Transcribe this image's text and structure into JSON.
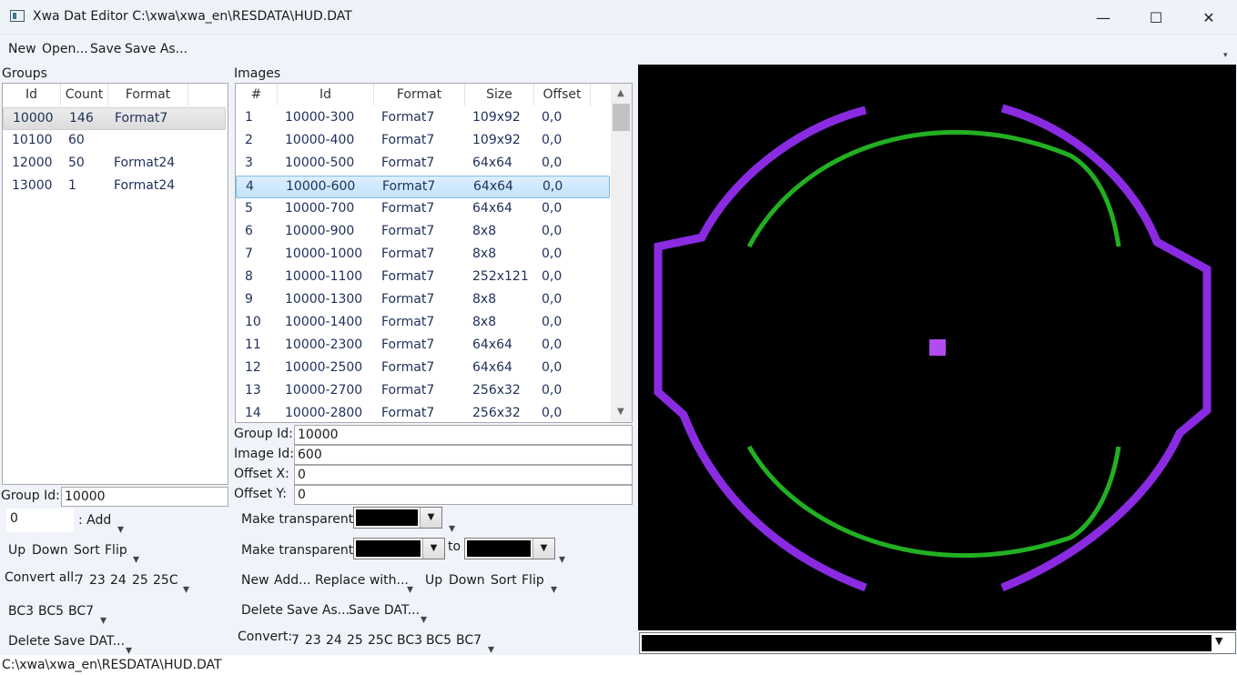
{
  "window": {
    "title": "Xwa Dat Editor C:\\xwa\\xwa_en\\RESDATA\\HUD.DAT",
    "minimize": "—",
    "maximize": "☐",
    "close": "✕"
  },
  "menu": {
    "new": "New",
    "open": "Open...",
    "save": "Save",
    "save_as": "Save As...",
    "overflow": "▾"
  },
  "groups": {
    "title": "Groups",
    "columns": [
      "Id",
      "Count",
      "Format"
    ],
    "rows": [
      {
        "id": "10000",
        "count": "146",
        "format": "Format7"
      },
      {
        "id": "10100",
        "count": "60",
        "format": ""
      },
      {
        "id": "12000",
        "count": "50",
        "format": "Format24"
      },
      {
        "id": "13000",
        "count": "1",
        "format": "Format24"
      }
    ],
    "selected_index": 0,
    "group_id_label": "Group Id:",
    "group_id_value": "10000",
    "add_value": "0",
    "add_label": ": Add",
    "up": "Up",
    "down": "Down",
    "sort": "Sort",
    "flip": "Flip",
    "convert_all_label": "Convert all:",
    "convert_formats_1": [
      "7",
      "23",
      "24",
      "25",
      "25C"
    ],
    "convert_formats_2": [
      "BC3",
      "BC5",
      "BC7"
    ],
    "delete": "Delete",
    "save_dat": "Save DAT..."
  },
  "images": {
    "title": "Images",
    "columns": [
      "#",
      "Id",
      "Format",
      "Size",
      "Offset"
    ],
    "rows": [
      {
        "n": "1",
        "id": "10000-300",
        "format": "Format7",
        "size": "109x92",
        "offset": "0,0"
      },
      {
        "n": "2",
        "id": "10000-400",
        "format": "Format7",
        "size": "109x92",
        "offset": "0,0"
      },
      {
        "n": "3",
        "id": "10000-500",
        "format": "Format7",
        "size": "64x64",
        "offset": "0,0"
      },
      {
        "n": "4",
        "id": "10000-600",
        "format": "Format7",
        "size": "64x64",
        "offset": "0,0"
      },
      {
        "n": "5",
        "id": "10000-700",
        "format": "Format7",
        "size": "64x64",
        "offset": "0,0"
      },
      {
        "n": "6",
        "id": "10000-900",
        "format": "Format7",
        "size": "8x8",
        "offset": "0,0"
      },
      {
        "n": "7",
        "id": "10000-1000",
        "format": "Format7",
        "size": "8x8",
        "offset": "0,0"
      },
      {
        "n": "8",
        "id": "10000-1100",
        "format": "Format7",
        "size": "252x121",
        "offset": "0,0"
      },
      {
        "n": "9",
        "id": "10000-1300",
        "format": "Format7",
        "size": "8x8",
        "offset": "0,0"
      },
      {
        "n": "10",
        "id": "10000-1400",
        "format": "Format7",
        "size": "8x8",
        "offset": "0,0"
      },
      {
        "n": "11",
        "id": "10000-2300",
        "format": "Format7",
        "size": "64x64",
        "offset": "0,0"
      },
      {
        "n": "12",
        "id": "10000-2500",
        "format": "Format7",
        "size": "64x64",
        "offset": "0,0"
      },
      {
        "n": "13",
        "id": "10000-2700",
        "format": "Format7",
        "size": "256x32",
        "offset": "0,0"
      },
      {
        "n": "14",
        "id": "10000-2800",
        "format": "Format7",
        "size": "256x32",
        "offset": "0,0"
      }
    ],
    "selected_index": 3,
    "group_id_label": "Group Id:",
    "group_id_value": "10000",
    "image_id_label": "Image Id:",
    "image_id_value": "600",
    "offset_x_label": "Offset X:",
    "offset_x_value": "0",
    "offset_y_label": "Offset Y:",
    "offset_y_value": "0",
    "make_transparent_label": "Make transparent:",
    "to_label": "to",
    "new": "New",
    "add": "Add...",
    "replace_with": "Replace with...",
    "up": "Up",
    "down": "Down",
    "sort": "Sort",
    "flip": "Flip",
    "delete": "Delete",
    "save_as": "Save As...",
    "save_dat": "Save DAT...",
    "convert_label": "Convert:",
    "convert_formats": [
      "7",
      "23",
      "24",
      "25",
      "25C",
      "BC3",
      "BC5",
      "BC7"
    ]
  },
  "preview": {
    "background": "#000000",
    "outer_color": "#8a2be2",
    "inner_color": "#22b022",
    "dot_color": "#b24cf0"
  },
  "status": {
    "path": "C:\\xwa\\xwa_en\\RESDATA\\HUD.DAT"
  }
}
